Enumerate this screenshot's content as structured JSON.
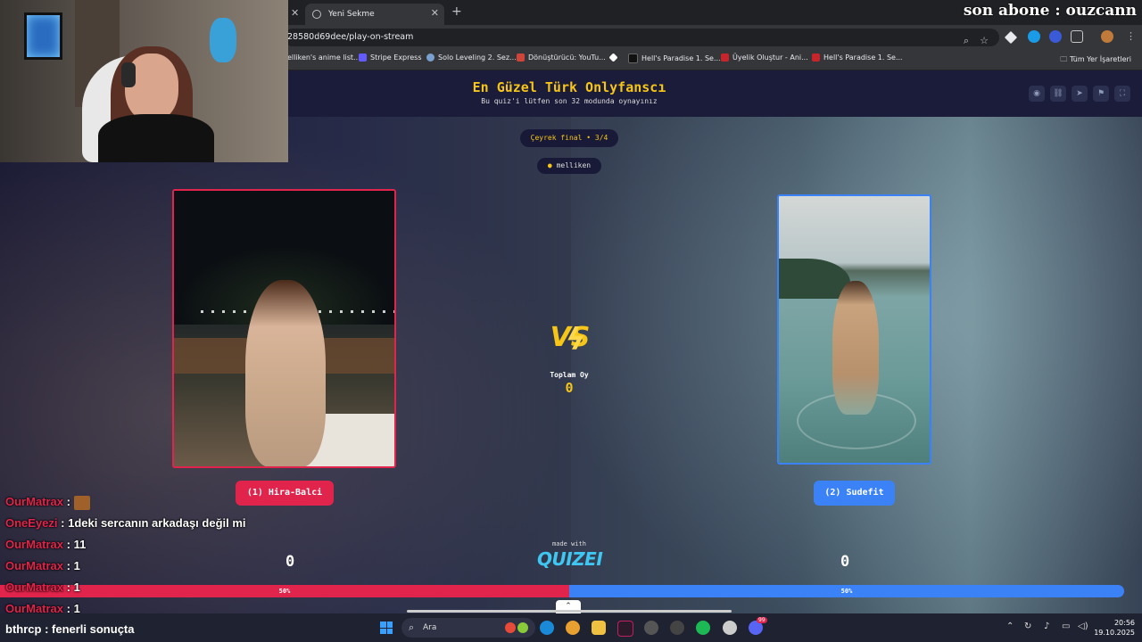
{
  "browser": {
    "tab_title": "Yeni Sekme",
    "url": "28580d69dee/play-on-stream",
    "overlay_text": "son abone : ouzcann",
    "bookmarks": [
      "elliken's anime list...",
      "Stripe Express",
      "Solo Leveling 2. Sez...",
      "Dönüştürücü: YouTu...",
      "Hell's Paradise 1. Se...",
      "Üyelik Oluştur - Ani...",
      "Hell's Paradise 1. Se..."
    ],
    "all_bookmarks": "Tüm Yer İşaretleri"
  },
  "quiz": {
    "title": "En Güzel Türk Onlyfanscı",
    "subtitle": "Bu quiz'i lütfen son 32 modunda oynayınız",
    "round": "Çeyrek final • 3/4",
    "creator": "melliken",
    "left": {
      "label": "(1) Hira-Balci",
      "score": "0",
      "percent": 50,
      "percent_label": "50%"
    },
    "right": {
      "label": "(2) Sudefit",
      "score": "0",
      "percent": 50,
      "percent_label": "50%"
    },
    "total_votes_label": "Toplam Oy",
    "total_votes": "0",
    "vs": "VS",
    "made_with": "made with",
    "brand": "QUIZEI",
    "accent_red": "#e0244b",
    "accent_blue": "#3b82f6",
    "accent_gold": "#f5c518"
  },
  "chat": [
    {
      "user": "OurMatrax",
      "msg": "",
      "emote": true
    },
    {
      "user": "OneEyezi",
      "msg": "1deki sercanın arkadaşı değil mi"
    },
    {
      "user": "OurMatrax",
      "msg": "11"
    },
    {
      "user": "OurMatrax",
      "msg": "1"
    },
    {
      "user": "OurMatrax",
      "msg": "1"
    },
    {
      "user": "OurMatrax",
      "msg": "1"
    },
    {
      "user": "bthrcp",
      "msg": "fenerli sonuçta"
    }
  ],
  "taskbar": {
    "search_placeholder": "Ara",
    "time": "20:56",
    "date": "19.10.2025",
    "badge": "99"
  }
}
